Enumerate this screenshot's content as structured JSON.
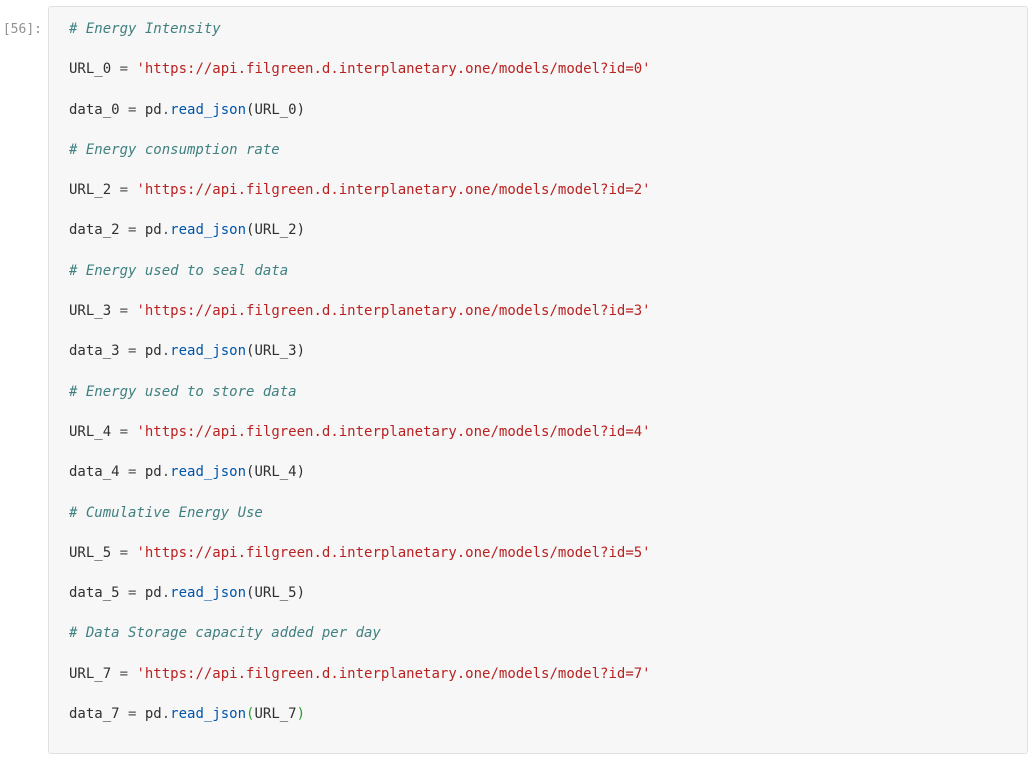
{
  "prompt": "[56]:",
  "blocks": [
    {
      "comment": "# Energy Intensity",
      "url_var": "URL_0",
      "url_val": "'https://api.filgreen.d.interplanetary.one/models/model?id=0'",
      "data_var": "data_0",
      "pd": "pd",
      "fn": "read_json",
      "arg": "URL_0",
      "last": false
    },
    {
      "comment": "# Energy consumption rate",
      "url_var": "URL_2",
      "url_val": "'https://api.filgreen.d.interplanetary.one/models/model?id=2'",
      "data_var": "data_2",
      "pd": "pd",
      "fn": "read_json",
      "arg": "URL_2",
      "last": false
    },
    {
      "comment": "# Energy used to seal data",
      "url_var": "URL_3",
      "url_val": "'https://api.filgreen.d.interplanetary.one/models/model?id=3'",
      "data_var": "data_3",
      "pd": "pd",
      "fn": "read_json",
      "arg": "URL_3",
      "last": false
    },
    {
      "comment": "# Energy used to store data",
      "url_var": "URL_4",
      "url_val": "'https://api.filgreen.d.interplanetary.one/models/model?id=4'",
      "data_var": "data_4",
      "pd": "pd",
      "fn": "read_json",
      "arg": "URL_4",
      "last": false
    },
    {
      "comment": "# Cumulative Energy Use",
      "url_var": "URL_5",
      "url_val": "'https://api.filgreen.d.interplanetary.one/models/model?id=5'",
      "data_var": "data_5",
      "pd": "pd",
      "fn": "read_json",
      "arg": "URL_5",
      "last": false
    },
    {
      "comment": "# Data Storage capacity added per day",
      "url_var": "URL_7",
      "url_val": "'https://api.filgreen.d.interplanetary.one/models/model?id=7'",
      "data_var": "data_7",
      "pd": "pd",
      "fn": "read_json",
      "arg": "URL_7",
      "last": true
    }
  ]
}
